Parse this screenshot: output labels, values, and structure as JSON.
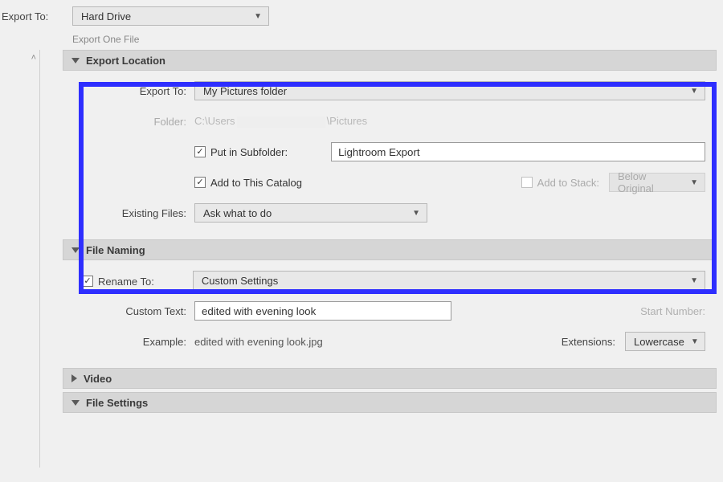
{
  "top": {
    "export_to_label": "Export To:",
    "export_to_value": "Hard Drive",
    "hint": "Export One File"
  },
  "panels": {
    "export_location": {
      "title": "Export Location",
      "export_to_label": "Export To:",
      "export_to_value": "My Pictures folder",
      "folder_label": "Folder:",
      "folder_path_prefix": "C:\\Users",
      "folder_path_suffix": "\\Pictures",
      "put_in_subfolder_label": "Put in Subfolder:",
      "subfolder_value": "Lightroom Export",
      "add_to_catalog_label": "Add to This Catalog",
      "add_to_stack_label": "Add to Stack:",
      "stack_value": "Below Original",
      "existing_files_label": "Existing Files:",
      "existing_files_value": "Ask what to do"
    },
    "file_naming": {
      "title": "File Naming",
      "rename_to_label": "Rename To:",
      "rename_to_value": "Custom Settings",
      "custom_text_label": "Custom Text:",
      "custom_text_value": "edited with evening look",
      "start_number_label": "Start Number:",
      "example_label": "Example:",
      "example_value": "edited with evening look.jpg",
      "extensions_label": "Extensions:",
      "extensions_value": "Lowercase"
    },
    "video": {
      "title": "Video"
    },
    "file_settings": {
      "title": "File Settings"
    }
  }
}
